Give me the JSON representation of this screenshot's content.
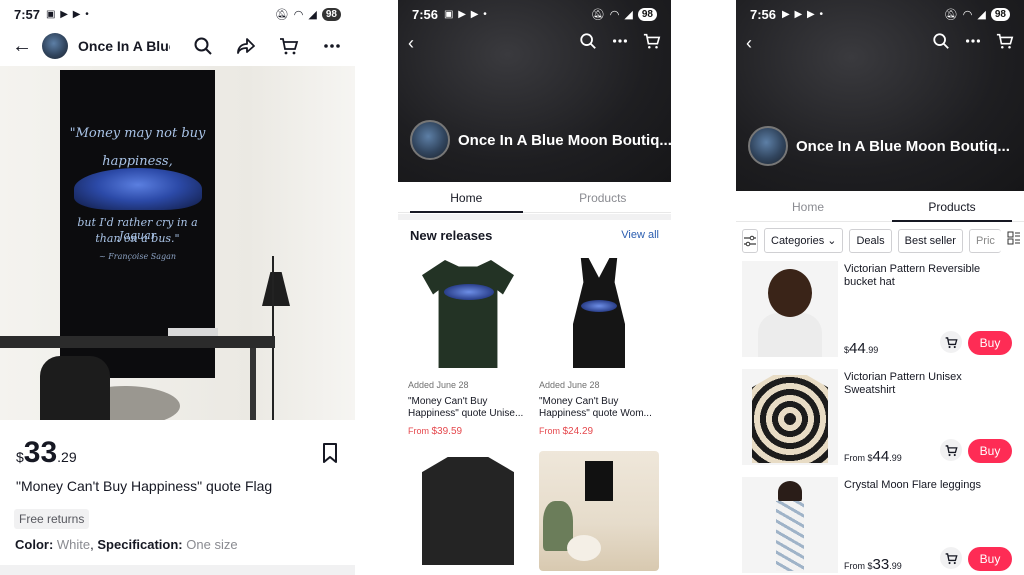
{
  "shop_name": "Once In A Blue Moon Boutiq...",
  "colors": {
    "accent": "#fe2c55",
    "link": "#2a5db0",
    "price_red": "#e5484d"
  },
  "panel1": {
    "status": {
      "time": "7:57",
      "battery": "98"
    },
    "nav": {
      "shop_name": "Once In A Blue M"
    },
    "flag_quote": {
      "l1": "\"Money may not buy",
      "l2": "happiness,",
      "l3": "but I'd rather cry in a Jaguar",
      "l4": "than on a bus.\"",
      "l5": "~ Françoise Sagan"
    },
    "price": {
      "currency": "$",
      "dollars": "33",
      "cents": ".29"
    },
    "title": "\"Money Can't Buy Happiness\" quote Flag",
    "badge": "Free returns",
    "spec": {
      "color_label": "Color:",
      "color_value": "White",
      "sep": ",",
      "spec_label": "Specification:",
      "spec_value": "One size"
    }
  },
  "panel2": {
    "status": {
      "time": "7:56",
      "battery": "98"
    },
    "shop_name": "Once In A Blue Moon Boutiq...",
    "tabs": [
      {
        "label": "Home"
      },
      {
        "label": "Products"
      }
    ],
    "section": {
      "title": "New releases",
      "view_all": "View all"
    },
    "cards": [
      {
        "added": "Added June 28",
        "name": "\"Money Can't Buy Happiness\" quote Unise...",
        "from": "From ",
        "price": "$39.59"
      },
      {
        "added": "Added June 28",
        "name": "\"Money Can't Buy Happiness\" quote Wom...",
        "from": "From ",
        "price": "$24.29"
      }
    ]
  },
  "panel3": {
    "status": {
      "time": "7:56",
      "battery": "98"
    },
    "shop_name": "Once In A Blue Moon Boutiq...",
    "tabs": [
      {
        "label": "Home"
      },
      {
        "label": "Products"
      }
    ],
    "filters": [
      "Categories",
      "Deals",
      "Best seller",
      "Pric"
    ],
    "products": [
      {
        "title": "Victorian Pattern Reversible bucket hat",
        "from": "",
        "currency": "$",
        "dollars": "44",
        "cents": ".99",
        "buy": "Buy"
      },
      {
        "title": "Victorian Pattern Unisex Sweatshirt",
        "from": "From ",
        "currency": "$",
        "dollars": "44",
        "cents": ".99",
        "buy": "Buy"
      },
      {
        "title": "Crystal Moon Flare leggings",
        "from": "From ",
        "currency": "$",
        "dollars": "33",
        "cents": ".99",
        "buy": "Buy"
      }
    ]
  }
}
